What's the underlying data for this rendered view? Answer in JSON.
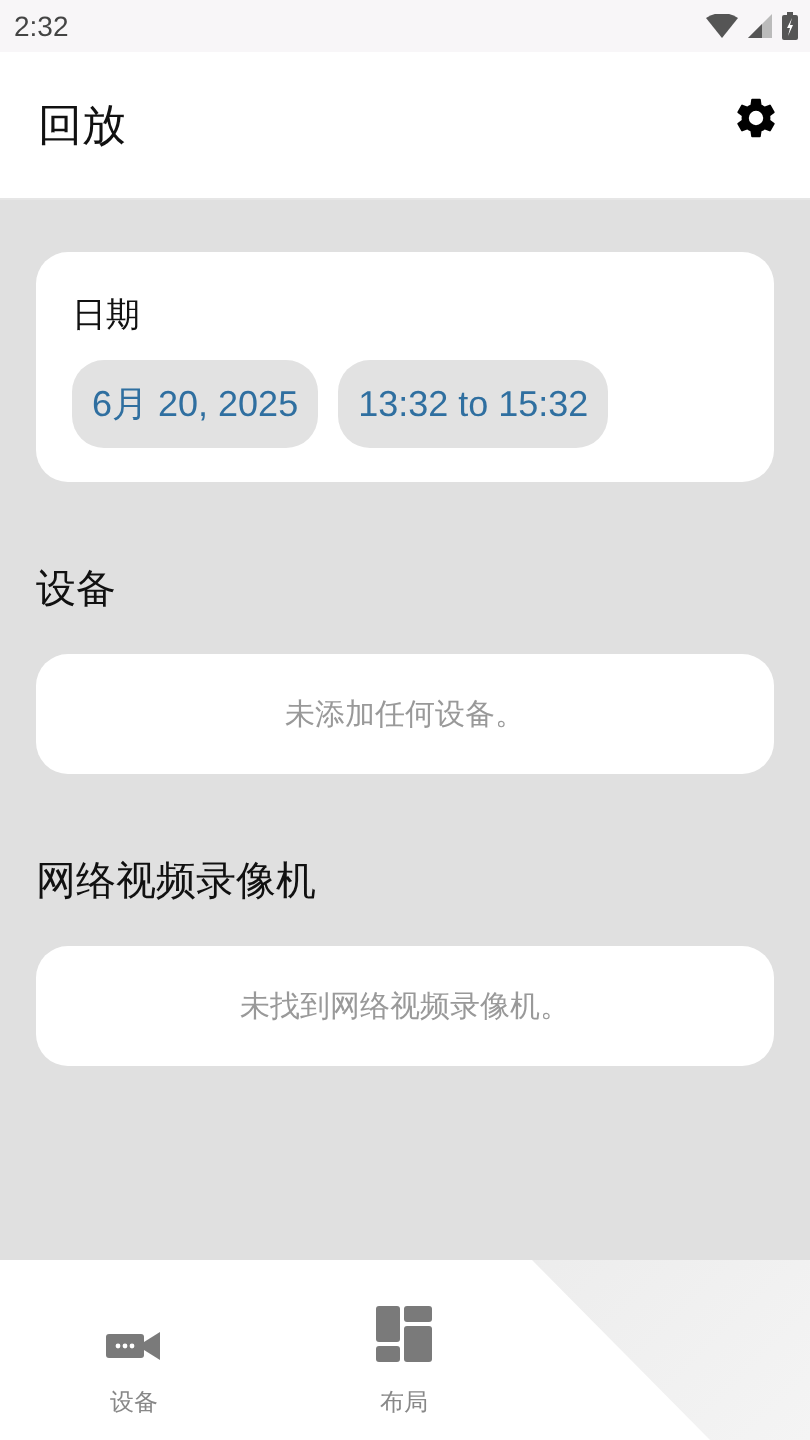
{
  "status_bar": {
    "time": "2:32"
  },
  "header": {
    "title": "回放"
  },
  "date_card": {
    "label": "日期",
    "date": "6月 20, 2025",
    "time_range": "13:32 to 15:32"
  },
  "sections": [
    {
      "title": "设备",
      "empty_message": "未添加任何设备。"
    },
    {
      "title": "网络视频录像机",
      "empty_message": "未找到网络视频录像机。"
    }
  ],
  "bottom_nav": [
    {
      "kind": "camera",
      "label": "设备",
      "selected": false
    },
    {
      "kind": "layout",
      "label": "布局",
      "selected": false
    }
  ]
}
